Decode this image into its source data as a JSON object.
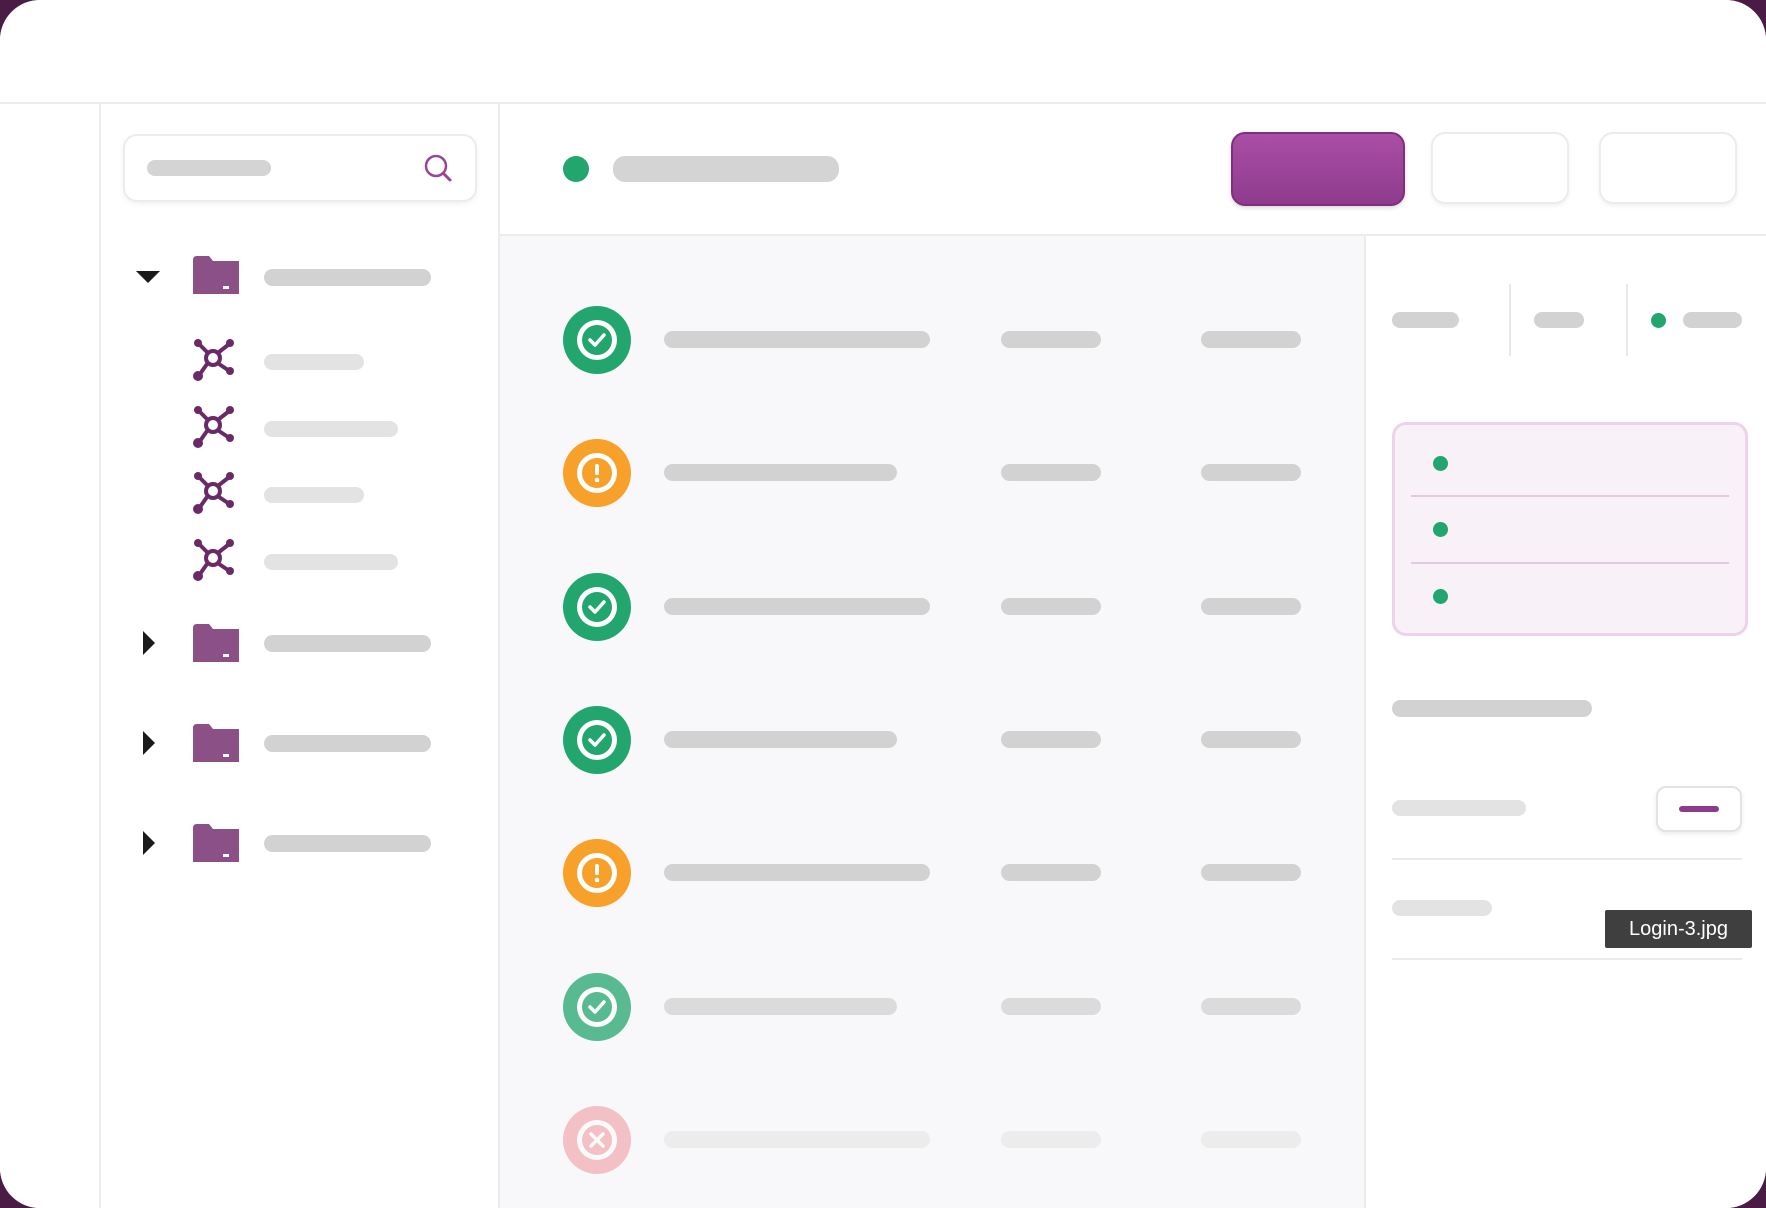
{
  "search": {
    "placeholder": "",
    "value": ""
  },
  "sidebar": {
    "folders": [
      {
        "expanded": true,
        "icon": "folder-icon",
        "children": 4
      },
      {
        "expanded": false,
        "icon": "folder-icon"
      },
      {
        "expanded": false,
        "icon": "folder-icon"
      },
      {
        "expanded": false,
        "icon": "folder-icon"
      }
    ],
    "child_icon": "network-node-icon"
  },
  "header": {
    "status": "online",
    "primary_action_icon": "none"
  },
  "list": {
    "rows": [
      {
        "status": "success"
      },
      {
        "status": "warning"
      },
      {
        "status": "success"
      },
      {
        "status": "success"
      },
      {
        "status": "warning"
      },
      {
        "status": "success"
      },
      {
        "status": "error"
      }
    ]
  },
  "details": {
    "card_rows": 3
  },
  "tooltip": {
    "text": "Login-3.jpg"
  },
  "colors": {
    "accent": "#9b4598",
    "success": "#22a66e",
    "warning": "#f7a02a",
    "error": "#f28d93",
    "frame": "#4a1b45",
    "skeleton": "#d2d2d2"
  }
}
